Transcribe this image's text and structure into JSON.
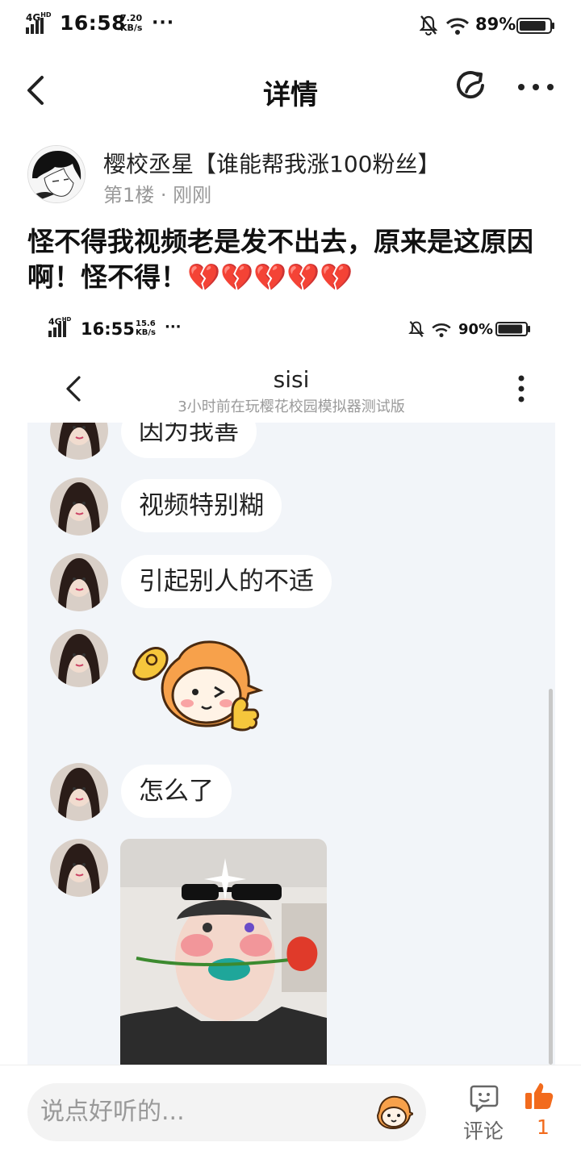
{
  "status_bar": {
    "network": "4G",
    "network_sup": "HD",
    "time": "16:58",
    "speed_value": "7.20",
    "speed_unit": "KB/s",
    "more": "···",
    "battery_percent": "89%",
    "battery_level": 0.89
  },
  "nav": {
    "title": "详情"
  },
  "post": {
    "username": "樱校丞星【谁能帮我涨100粉丝】",
    "meta": "第1楼 · 刚刚",
    "text": "怪不得我视频老是发不出去，原来是这原因啊！怪不得！💔💔💔💔💔"
  },
  "embedded_screenshot": {
    "status_bar": {
      "network": "4G",
      "network_sup": "HD",
      "time": "16:55",
      "speed_value": "15.6",
      "speed_unit": "KB/s",
      "more": "···",
      "battery_percent": "90%",
      "battery_level": 0.9
    },
    "chat": {
      "contact_name": "sisi",
      "contact_status": "3小时前在玩樱花校园模拟器测试版",
      "messages": [
        {
          "type": "text",
          "text": "因为我善"
        },
        {
          "type": "text",
          "text": "视频特别糊"
        },
        {
          "type": "text",
          "text": "引起别人的不适"
        },
        {
          "type": "sticker",
          "icon": "mascot-thumbs-up-sticker"
        },
        {
          "type": "text",
          "text": "怎么了"
        },
        {
          "type": "image",
          "icon": "selfie-photo"
        }
      ]
    }
  },
  "bottom_bar": {
    "input_placeholder": "说点好听的...",
    "comment_label": "评论",
    "like_count": "1"
  },
  "colors": {
    "accent": "#f26b1d",
    "chat_bg": "#f2f5f9"
  }
}
